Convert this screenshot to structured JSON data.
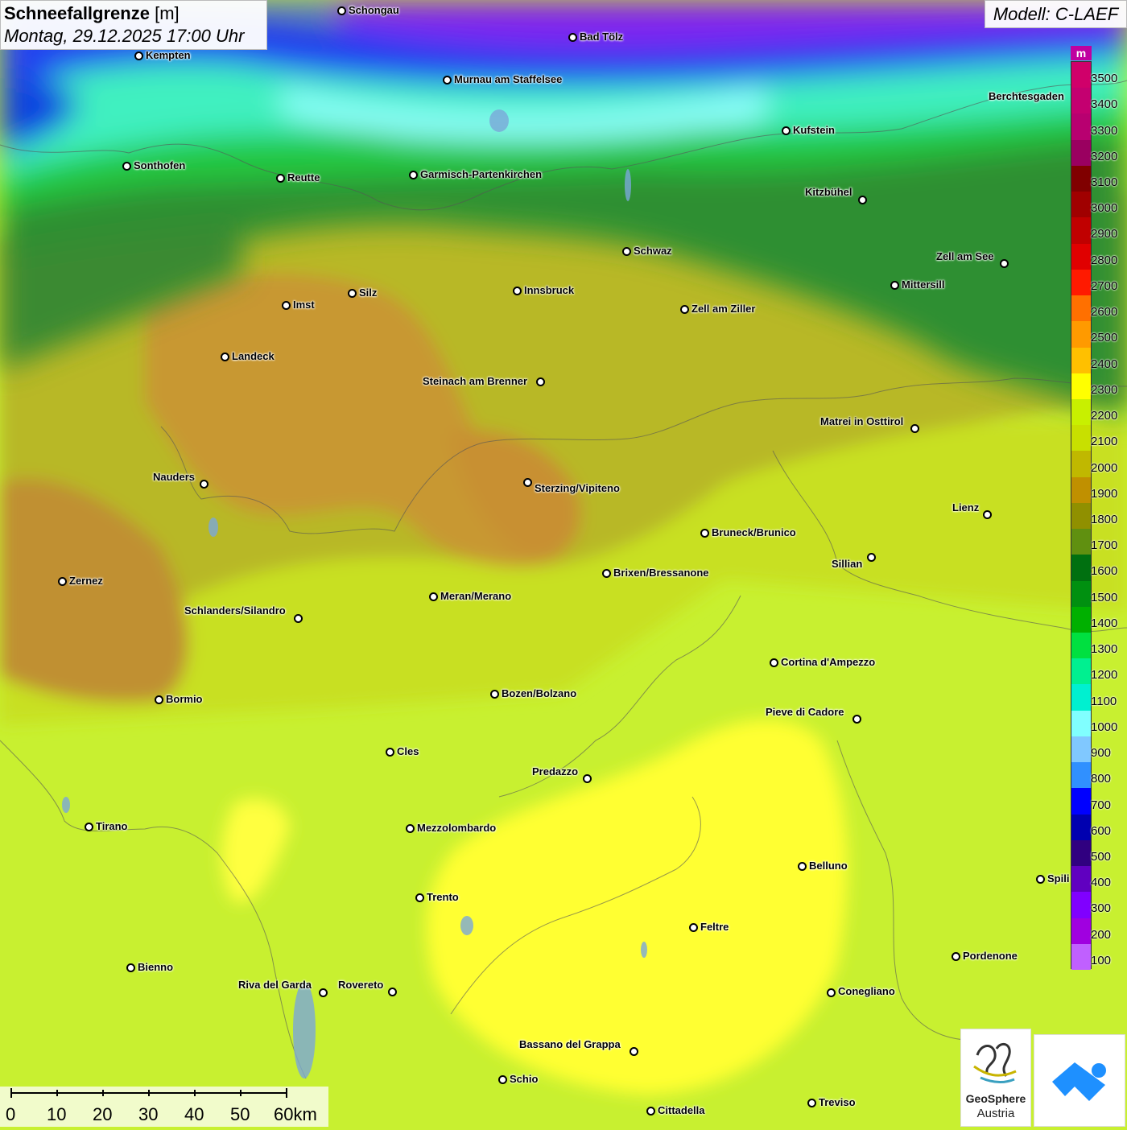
{
  "header": {
    "title": "Schneefallgrenze",
    "unit": "[m]",
    "datetime": "Montag, 29.12.2025 17:00 Uhr",
    "model": "Modell: C-LAEF"
  },
  "legend": {
    "unit": "m",
    "levels": [
      {
        "label": "3500",
        "color": "#d0006a"
      },
      {
        "label": "3400",
        "color": "#c40070"
      },
      {
        "label": "3300",
        "color": "#b80070"
      },
      {
        "label": "3200",
        "color": "#9a0060"
      },
      {
        "label": "3100",
        "color": "#800000"
      },
      {
        "label": "3000",
        "color": "#a00000"
      },
      {
        "label": "2900",
        "color": "#c00000"
      },
      {
        "label": "2800",
        "color": "#e00000"
      },
      {
        "label": "2700",
        "color": "#ff1a00"
      },
      {
        "label": "2600",
        "color": "#ff7000"
      },
      {
        "label": "2500",
        "color": "#ff9a00"
      },
      {
        "label": "2400",
        "color": "#ffc000"
      },
      {
        "label": "2300",
        "color": "#ffff00"
      },
      {
        "label": "2200",
        "color": "#c8f000"
      },
      {
        "label": "2100",
        "color": "#c8e000"
      },
      {
        "label": "2000",
        "color": "#c0b800"
      },
      {
        "label": "1900",
        "color": "#c09000"
      },
      {
        "label": "1800",
        "color": "#909000"
      },
      {
        "label": "1700",
        "color": "#609010"
      },
      {
        "label": "1600",
        "color": "#007010"
      },
      {
        "label": "1500",
        "color": "#009010"
      },
      {
        "label": "1400",
        "color": "#00b000"
      },
      {
        "label": "1300",
        "color": "#00e040"
      },
      {
        "label": "1200",
        "color": "#00f090"
      },
      {
        "label": "1100",
        "color": "#00f0d0"
      },
      {
        "label": "1000",
        "color": "#80ffff"
      },
      {
        "label": "900",
        "color": "#80c8ff"
      },
      {
        "label": "800",
        "color": "#3090ff"
      },
      {
        "label": "700",
        "color": "#0000ff"
      },
      {
        "label": "600",
        "color": "#0000b0"
      },
      {
        "label": "500",
        "color": "#300080"
      },
      {
        "label": "400",
        "color": "#6000c0"
      },
      {
        "label": "300",
        "color": "#8000ff"
      },
      {
        "label": "200",
        "color": "#a000e0"
      },
      {
        "label": "100",
        "color": "#c060ff"
      }
    ]
  },
  "cities": [
    {
      "name": "Schongau"
    },
    {
      "name": "Bad Tölz"
    },
    {
      "name": "Kempten"
    },
    {
      "name": "Murnau am Staffelsee"
    },
    {
      "name": "Berchtesgaden"
    },
    {
      "name": "Kufstein"
    },
    {
      "name": "Sonthofen"
    },
    {
      "name": "Reutte"
    },
    {
      "name": "Garmisch-Partenkirchen"
    },
    {
      "name": "Kitzbühel"
    },
    {
      "name": "Schwaz"
    },
    {
      "name": "Zell am See"
    },
    {
      "name": "Innsbruck"
    },
    {
      "name": "Mittersill"
    },
    {
      "name": "Imst"
    },
    {
      "name": "Silz"
    },
    {
      "name": "Zell am Ziller"
    },
    {
      "name": "Landeck"
    },
    {
      "name": "Steinach am Brenner"
    },
    {
      "name": "Matrei in Osttirol"
    },
    {
      "name": "Nauders"
    },
    {
      "name": "Sterzing/Vipiteno"
    },
    {
      "name": "Lienz"
    },
    {
      "name": "Bruneck/Brunico"
    },
    {
      "name": "Sillian"
    },
    {
      "name": "Brixen/Bressanone"
    },
    {
      "name": "Zernez"
    },
    {
      "name": "Meran/Merano"
    },
    {
      "name": "Schlanders/Silandro"
    },
    {
      "name": "Cortina d'Ampezzo"
    },
    {
      "name": "Bozen/Bolzano"
    },
    {
      "name": "Bormio"
    },
    {
      "name": "Pieve di Cadore"
    },
    {
      "name": "Cles"
    },
    {
      "name": "Predazzo"
    },
    {
      "name": "Tirano"
    },
    {
      "name": "Mezzolombardo"
    },
    {
      "name": "Belluno"
    },
    {
      "name": "Spili"
    },
    {
      "name": "Trento"
    },
    {
      "name": "Feltre"
    },
    {
      "name": "Pordenone"
    },
    {
      "name": "Bienno"
    },
    {
      "name": "Riva del Garda"
    },
    {
      "name": "Rovereto"
    },
    {
      "name": "Conegliano"
    },
    {
      "name": "Bassano del Grappa"
    },
    {
      "name": "Schio"
    },
    {
      "name": "Treviso"
    },
    {
      "name": "Cittadella"
    }
  ],
  "scalebar": {
    "ticks": [
      "0",
      "10",
      "20",
      "30",
      "40",
      "50",
      "60km"
    ]
  },
  "logos": {
    "geosphere_line1": "GeoSphere",
    "geosphere_line2": "Austria"
  }
}
